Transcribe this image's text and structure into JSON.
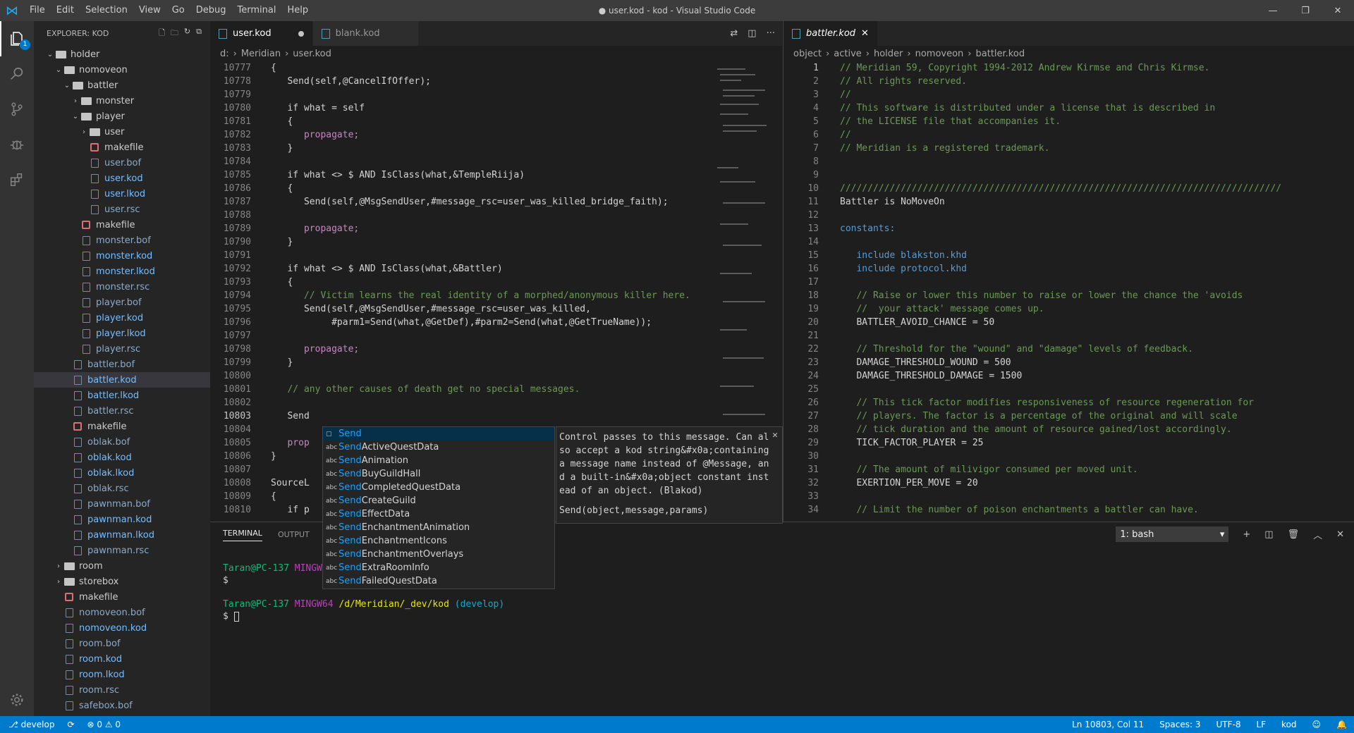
{
  "title": "● user.kod - kod - Visual Studio Code",
  "menu": [
    "File",
    "Edit",
    "Selection",
    "View",
    "Go",
    "Debug",
    "Terminal",
    "Help"
  ],
  "explorer": {
    "header": "EXPLORER: KOD",
    "badge": "1"
  },
  "tree": [
    {
      "label": "holder",
      "kind": "folder",
      "indent": 1,
      "open": true
    },
    {
      "label": "nomoveon",
      "kind": "folder",
      "indent": 2,
      "open": true
    },
    {
      "label": "battler",
      "kind": "folder",
      "indent": 3,
      "open": true
    },
    {
      "label": "monster",
      "kind": "folder",
      "indent": 4,
      "open": false
    },
    {
      "label": "player",
      "kind": "folder",
      "indent": 4,
      "open": true
    },
    {
      "label": "user",
      "kind": "folder",
      "indent": 5,
      "open": false
    },
    {
      "label": "makefile",
      "kind": "mk",
      "indent": 5
    },
    {
      "label": "user.bof",
      "kind": "file",
      "indent": 5,
      "grey": true
    },
    {
      "label": "user.kod",
      "kind": "file",
      "indent": 5
    },
    {
      "label": "user.lkod",
      "kind": "file",
      "indent": 5
    },
    {
      "label": "user.rsc",
      "kind": "file",
      "indent": 5,
      "grey": true
    },
    {
      "label": "makefile",
      "kind": "mk",
      "indent": 4
    },
    {
      "label": "monster.bof",
      "kind": "file",
      "indent": 4,
      "grey": true
    },
    {
      "label": "monster.kod",
      "kind": "file",
      "indent": 4
    },
    {
      "label": "monster.lkod",
      "kind": "file",
      "indent": 4
    },
    {
      "label": "monster.rsc",
      "kind": "file",
      "indent": 4,
      "grey": true
    },
    {
      "label": "player.bof",
      "kind": "file",
      "indent": 4,
      "grey": true
    },
    {
      "label": "player.kod",
      "kind": "file",
      "indent": 4
    },
    {
      "label": "player.lkod",
      "kind": "file",
      "indent": 4
    },
    {
      "label": "player.rsc",
      "kind": "file",
      "indent": 4,
      "grey": true
    },
    {
      "label": "battler.bof",
      "kind": "file",
      "indent": 3,
      "grey": true
    },
    {
      "label": "battler.kod",
      "kind": "file",
      "indent": 3,
      "sel": true
    },
    {
      "label": "battler.lkod",
      "kind": "file",
      "indent": 3
    },
    {
      "label": "battler.rsc",
      "kind": "file",
      "indent": 3,
      "grey": true
    },
    {
      "label": "makefile",
      "kind": "mk",
      "indent": 3
    },
    {
      "label": "oblak.bof",
      "kind": "file",
      "indent": 3,
      "grey": true
    },
    {
      "label": "oblak.kod",
      "kind": "file",
      "indent": 3
    },
    {
      "label": "oblak.lkod",
      "kind": "file",
      "indent": 3
    },
    {
      "label": "oblak.rsc",
      "kind": "file",
      "indent": 3,
      "grey": true
    },
    {
      "label": "pawnman.bof",
      "kind": "file",
      "indent": 3,
      "grey": true
    },
    {
      "label": "pawnman.kod",
      "kind": "file",
      "indent": 3
    },
    {
      "label": "pawnman.lkod",
      "kind": "file",
      "indent": 3
    },
    {
      "label": "pawnman.rsc",
      "kind": "file",
      "indent": 3,
      "grey": true
    },
    {
      "label": "room",
      "kind": "folder",
      "indent": 2,
      "open": false
    },
    {
      "label": "storebox",
      "kind": "folder",
      "indent": 2,
      "open": false
    },
    {
      "label": "makefile",
      "kind": "mk",
      "indent": 2
    },
    {
      "label": "nomoveon.bof",
      "kind": "file",
      "indent": 2,
      "grey": true
    },
    {
      "label": "nomoveon.kod",
      "kind": "file",
      "indent": 2
    },
    {
      "label": "room.bof",
      "kind": "file",
      "indent": 2,
      "grey": true
    },
    {
      "label": "room.kod",
      "kind": "file",
      "indent": 2
    },
    {
      "label": "room.lkod",
      "kind": "file",
      "indent": 2
    },
    {
      "label": "room.rsc",
      "kind": "file",
      "indent": 2,
      "grey": true
    },
    {
      "label": "safebox.bof",
      "kind": "file",
      "indent": 2,
      "grey": true
    }
  ],
  "left_tabs": [
    {
      "label": "user.kod",
      "active": true,
      "dirty": true
    },
    {
      "label": "blank.kod",
      "active": false
    }
  ],
  "left_breadcrumb": [
    "d:",
    "Meridian",
    "user.kod"
  ],
  "left_lines": [
    {
      "n": "10777",
      "t": "{"
    },
    {
      "n": "10778",
      "t": "   Send(self,@CancelIfOffer);"
    },
    {
      "n": "10779",
      "t": ""
    },
    {
      "n": "10780",
      "t": "   if what = self"
    },
    {
      "n": "10781",
      "t": "   {"
    },
    {
      "n": "10782",
      "t": "      propagate;"
    },
    {
      "n": "10783",
      "t": "   }"
    },
    {
      "n": "10784",
      "t": ""
    },
    {
      "n": "10785",
      "t": "   if what <> $ AND IsClass(what,&TempleRiija)"
    },
    {
      "n": "10786",
      "t": "   {"
    },
    {
      "n": "10787",
      "t": "      Send(self,@MsgSendUser,#message_rsc=user_was_killed_bridge_faith);"
    },
    {
      "n": "10788",
      "t": ""
    },
    {
      "n": "10789",
      "t": "      propagate;"
    },
    {
      "n": "10790",
      "t": "   }"
    },
    {
      "n": "10791",
      "t": ""
    },
    {
      "n": "10792",
      "t": "   if what <> $ AND IsClass(what,&Battler)"
    },
    {
      "n": "10793",
      "t": "   {"
    },
    {
      "n": "10794",
      "t": "      // Victim learns the real identity of a morphed/anonymous killer here."
    },
    {
      "n": "10795",
      "t": "      Send(self,@MsgSendUser,#message_rsc=user_was_killed,"
    },
    {
      "n": "10796",
      "t": "           #parm1=Send(what,@GetDef),#parm2=Send(what,@GetTrueName));"
    },
    {
      "n": "10797",
      "t": ""
    },
    {
      "n": "10798",
      "t": "      propagate;"
    },
    {
      "n": "10799",
      "t": "   }"
    },
    {
      "n": "10800",
      "t": ""
    },
    {
      "n": "10801",
      "t": "   // any other causes of death get no special messages."
    },
    {
      "n": "10802",
      "t": ""
    },
    {
      "n": "10803",
      "t": "   Send"
    },
    {
      "n": "10804",
      "t": ""
    },
    {
      "n": "10805",
      "t": "   prop"
    },
    {
      "n": "10806",
      "t": "}"
    },
    {
      "n": "10807",
      "t": ""
    },
    {
      "n": "10808",
      "t": "SourceL"
    },
    {
      "n": "10809",
      "t": "{"
    },
    {
      "n": "10810",
      "t": "   if p"
    }
  ],
  "right_tab": "battler.kod",
  "right_breadcrumb": [
    "object",
    "active",
    "holder",
    "nomoveon",
    "battler.kod"
  ],
  "right_lines": [
    {
      "n": "1",
      "t": "// Meridian 59, Copyright 1994-2012 Andrew Kirmse and Chris Kirmse."
    },
    {
      "n": "2",
      "t": "// All rights reserved."
    },
    {
      "n": "3",
      "t": "//"
    },
    {
      "n": "4",
      "t": "// This software is distributed under a license that is described in"
    },
    {
      "n": "5",
      "t": "// the LICENSE file that accompanies it."
    },
    {
      "n": "6",
      "t": "//"
    },
    {
      "n": "7",
      "t": "// Meridian is a registered trademark."
    },
    {
      "n": "8",
      "t": ""
    },
    {
      "n": "9",
      "t": ""
    },
    {
      "n": "10",
      "t": "////////////////////////////////////////////////////////////////////////////////"
    },
    {
      "n": "11",
      "t": "Battler is NoMoveOn"
    },
    {
      "n": "12",
      "t": ""
    },
    {
      "n": "13",
      "t": "constants:"
    },
    {
      "n": "14",
      "t": ""
    },
    {
      "n": "15",
      "t": "   include blakston.khd"
    },
    {
      "n": "16",
      "t": "   include protocol.khd"
    },
    {
      "n": "17",
      "t": ""
    },
    {
      "n": "18",
      "t": "   // Raise or lower this number to raise or lower the chance the 'avoids"
    },
    {
      "n": "19",
      "t": "   //  your attack' message comes up."
    },
    {
      "n": "20",
      "t": "   BATTLER_AVOID_CHANCE = 50"
    },
    {
      "n": "21",
      "t": ""
    },
    {
      "n": "22",
      "t": "   // Threshold for the \"wound\" and \"damage\" levels of feedback."
    },
    {
      "n": "23",
      "t": "   DAMAGE_THRESHOLD_WOUND = 500"
    },
    {
      "n": "24",
      "t": "   DAMAGE_THRESHOLD_DAMAGE = 1500"
    },
    {
      "n": "25",
      "t": ""
    },
    {
      "n": "26",
      "t": "   // This tick factor modifies responsiveness of resource regeneration for"
    },
    {
      "n": "27",
      "t": "   // players. The factor is a percentage of the original and will scale"
    },
    {
      "n": "28",
      "t": "   // tick duration and the amount of resource gained/lost accordingly."
    },
    {
      "n": "29",
      "t": "   TICK_FACTOR_PLAYER = 25"
    },
    {
      "n": "30",
      "t": ""
    },
    {
      "n": "31",
      "t": "   // The amount of milivigor consumed per moved unit."
    },
    {
      "n": "32",
      "t": "   EXERTION_PER_MOVE = 20"
    },
    {
      "n": "33",
      "t": ""
    },
    {
      "n": "34",
      "t": "   // Limit the number of poison enchantments a battler can have."
    }
  ],
  "suggest": [
    {
      "hl": "Send",
      "rest": ""
    },
    {
      "hl": "Send",
      "rest": "ActiveQuestData"
    },
    {
      "hl": "Send",
      "rest": "Animation"
    },
    {
      "hl": "Send",
      "rest": "BuyGuildHall"
    },
    {
      "hl": "Send",
      "rest": "CompletedQuestData"
    },
    {
      "hl": "Send",
      "rest": "CreateGuild"
    },
    {
      "hl": "Send",
      "rest": "EffectData"
    },
    {
      "hl": "Send",
      "rest": "EnchantmentAnimation"
    },
    {
      "hl": "Send",
      "rest": "EnchantmentIcons"
    },
    {
      "hl": "Send",
      "rest": "EnchantmentOverlays"
    },
    {
      "hl": "Send",
      "rest": "ExtraRoomInfo"
    },
    {
      "hl": "Send",
      "rest": "FailedQuestData"
    }
  ],
  "suggest_detail": {
    "l1": "Control passes to this message. Can al",
    "l2": "so accept a kod string&#x0a;containing",
    "l3": "a message name instead of @Message, an",
    "l4": "d a built-in&#x0a;object constant inst",
    "l5": "ead of an object. (Blakod)",
    "sig": "Send(object,message,params)"
  },
  "panel": {
    "tabs": [
      "TERMINAL",
      "OUTPUT",
      "P"
    ],
    "shell": "1: bash"
  },
  "terminal": {
    "user": "Taran@PC-137",
    "sys": "MINGW64",
    "path": "/d/Meridian/_dev/kod",
    "branch": "(develop)",
    "prompt": "$"
  },
  "status": {
    "branch": "develop",
    "errors": "0",
    "warnings": "0",
    "pos": "Ln 10803, Col 11",
    "spaces": "Spaces: 3",
    "enc": "UTF-8",
    "eol": "LF",
    "lang": "kod"
  }
}
